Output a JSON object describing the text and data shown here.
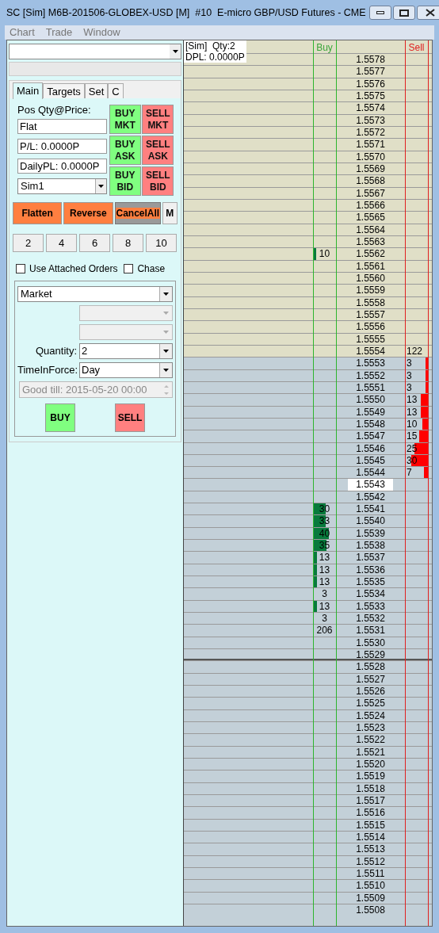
{
  "window": {
    "title": "SC [Sim] M6B-201506-GLOBEX-USD [M]  #10  E-micro GBP/USD Futures - CME"
  },
  "menu": [
    "Chart",
    "Trade",
    "Window"
  ],
  "left_panel": {
    "tabs": [
      {
        "label": "Main",
        "selected": true
      },
      {
        "label": "Targets",
        "selected": false
      },
      {
        "label": "Set",
        "selected": false
      },
      {
        "label": "C",
        "selected": false
      }
    ],
    "position_label": "Pos Qty@Price:",
    "fields": [
      "Flat",
      "P/L: 0.0000P",
      "DailyPL: 0.0000P"
    ],
    "account": "Sim1",
    "order_buttons": [
      {
        "label": "BUY MKT",
        "kind": "buy"
      },
      {
        "label": "SELL MKT",
        "kind": "sell"
      },
      {
        "label": "BUY ASK",
        "kind": "buy"
      },
      {
        "label": "SELL ASK",
        "kind": "sell"
      },
      {
        "label": "BUY BID",
        "kind": "buy"
      },
      {
        "label": "SELL BID",
        "kind": "sell"
      }
    ],
    "actions": [
      {
        "label": "Flatten",
        "kind": "orange"
      },
      {
        "label": "Reverse",
        "kind": "orange"
      },
      {
        "label": "CancelAll",
        "kind": "cancel"
      },
      {
        "label": "M",
        "kind": "plain"
      }
    ],
    "quantity_presets": [
      "2",
      "4",
      "6",
      "8",
      "10"
    ],
    "checkboxes": [
      {
        "label": "Use Attached Orders",
        "checked": false
      },
      {
        "label": "Chase",
        "checked": false
      }
    ],
    "order_type": "Market",
    "quantity": {
      "label": "Quantity:",
      "value": "2"
    },
    "time_in_force": {
      "label": "TimeInForce:",
      "value": "Day"
    },
    "good_till": "Good till: 2015-05-20 00:00",
    "submit": [
      {
        "label": "BUY",
        "kind": "buy"
      },
      {
        "label": "SELL",
        "kind": "sell"
      }
    ]
  },
  "ladder": {
    "account_info": [
      "[Sim]  Qty:2",
      "DPL: 0.0000P"
    ],
    "columns": [
      "Buy",
      "Sell"
    ],
    "rows": [
      {
        "price": "1.5578",
        "kind": "upper"
      },
      {
        "price": "1.5577",
        "kind": "upper"
      },
      {
        "price": "1.5576",
        "kind": "upper"
      },
      {
        "price": "1.5575",
        "kind": "upper"
      },
      {
        "price": "1.5574",
        "kind": "upper"
      },
      {
        "price": "1.5573",
        "kind": "upper"
      },
      {
        "price": "1.5572",
        "kind": "upper"
      },
      {
        "price": "1.5571",
        "kind": "upper"
      },
      {
        "price": "1.5570",
        "kind": "upper"
      },
      {
        "price": "1.5569",
        "kind": "upper"
      },
      {
        "price": "1.5568",
        "kind": "upper"
      },
      {
        "price": "1.5567",
        "kind": "upper"
      },
      {
        "price": "1.5566",
        "kind": "upper"
      },
      {
        "price": "1.5565",
        "kind": "upper"
      },
      {
        "price": "1.5564",
        "kind": "upper"
      },
      {
        "price": "1.5563",
        "kind": "upper"
      },
      {
        "price": "1.5562",
        "kind": "upper",
        "buy": {
          "qty": "10",
          "level": 0.14
        }
      },
      {
        "price": "1.5561",
        "kind": "upper"
      },
      {
        "price": "1.5560",
        "kind": "upper"
      },
      {
        "price": "1.5559",
        "kind": "upper"
      },
      {
        "price": "1.5558",
        "kind": "upper"
      },
      {
        "price": "1.5557",
        "kind": "upper"
      },
      {
        "price": "1.5556",
        "kind": "upper"
      },
      {
        "price": "1.5555",
        "kind": "upper"
      },
      {
        "price": "1.5554",
        "kind": "upper",
        "sell": {
          "qty": "122"
        }
      },
      {
        "price": "1.5553",
        "kind": "lower",
        "sell": {
          "qty": "3",
          "level": 0.1
        }
      },
      {
        "price": "1.5552",
        "kind": "lower",
        "sell": {
          "qty": "3",
          "level": 0.1
        }
      },
      {
        "price": "1.5551",
        "kind": "lower",
        "sell": {
          "qty": "3",
          "level": 0.1
        }
      },
      {
        "price": "1.5550",
        "kind": "lower",
        "sell": {
          "qty": "13",
          "level": 0.3
        }
      },
      {
        "price": "1.5549",
        "kind": "lower",
        "sell": {
          "qty": "13",
          "level": 0.3
        }
      },
      {
        "price": "1.5548",
        "kind": "lower",
        "sell": {
          "qty": "10",
          "level": 0.25
        }
      },
      {
        "price": "1.5547",
        "kind": "lower",
        "sell": {
          "qty": "15",
          "level": 0.38
        }
      },
      {
        "price": "1.5546",
        "kind": "lower",
        "sell": {
          "qty": "25",
          "level": 0.58
        }
      },
      {
        "price": "1.5545",
        "kind": "lower",
        "sell": {
          "qty": "30",
          "level": 0.72
        }
      },
      {
        "price": "1.5544",
        "kind": "lower",
        "sell": {
          "qty": "7",
          "level": 0.18
        }
      },
      {
        "price": "1.5543",
        "kind": "last"
      },
      {
        "price": "1.5542",
        "kind": "lower"
      },
      {
        "price": "1.5541",
        "kind": "lower",
        "buy": {
          "qty": "30",
          "level": 0.55
        }
      },
      {
        "price": "1.5540",
        "kind": "lower",
        "buy": {
          "qty": "33",
          "level": 0.55
        }
      },
      {
        "price": "1.5539",
        "kind": "lower",
        "buy": {
          "qty": "40",
          "level": 0.69
        }
      },
      {
        "price": "1.5538",
        "kind": "lower",
        "buy": {
          "qty": "35",
          "level": 0.6
        }
      },
      {
        "price": "1.5537",
        "kind": "lower",
        "buy": {
          "qty": "13",
          "level": 0.17
        }
      },
      {
        "price": "1.5536",
        "kind": "lower",
        "buy": {
          "qty": "13",
          "level": 0.17
        }
      },
      {
        "price": "1.5535",
        "kind": "lower",
        "buy": {
          "qty": "13",
          "level": 0.17
        }
      },
      {
        "price": "1.5534",
        "kind": "lower",
        "buy": {
          "qty": "3"
        }
      },
      {
        "price": "1.5533",
        "kind": "lower",
        "buy": {
          "qty": "13",
          "level": 0.17
        }
      },
      {
        "price": "1.5532",
        "kind": "lower",
        "buy": {
          "qty": "3"
        }
      },
      {
        "price": "1.5531",
        "kind": "lower",
        "buy": {
          "qty": "206"
        }
      },
      {
        "price": "1.5530",
        "kind": "lower"
      },
      {
        "price": "1.5529",
        "kind": "lower-end"
      },
      {
        "price": "1.5528",
        "kind": "lower"
      },
      {
        "price": "1.5527",
        "kind": "lower"
      },
      {
        "price": "1.5526",
        "kind": "lower"
      },
      {
        "price": "1.5525",
        "kind": "lower"
      },
      {
        "price": "1.5524",
        "kind": "lower"
      },
      {
        "price": "1.5523",
        "kind": "lower"
      },
      {
        "price": "1.5522",
        "kind": "lower"
      },
      {
        "price": "1.5521",
        "kind": "lower"
      },
      {
        "price": "1.5520",
        "kind": "lower"
      },
      {
        "price": "1.5519",
        "kind": "lower"
      },
      {
        "price": "1.5518",
        "kind": "lower"
      },
      {
        "price": "1.5517",
        "kind": "lower"
      },
      {
        "price": "1.5516",
        "kind": "lower"
      },
      {
        "price": "1.5515",
        "kind": "lower"
      },
      {
        "price": "1.5514",
        "kind": "lower"
      },
      {
        "price": "1.5513",
        "kind": "lower"
      },
      {
        "price": "1.5512",
        "kind": "lower"
      },
      {
        "price": "1.5511",
        "kind": "lower"
      },
      {
        "price": "1.5510",
        "kind": "lower"
      },
      {
        "price": "1.5509",
        "kind": "lower"
      },
      {
        "price": "1.5508",
        "kind": "lower"
      }
    ]
  }
}
